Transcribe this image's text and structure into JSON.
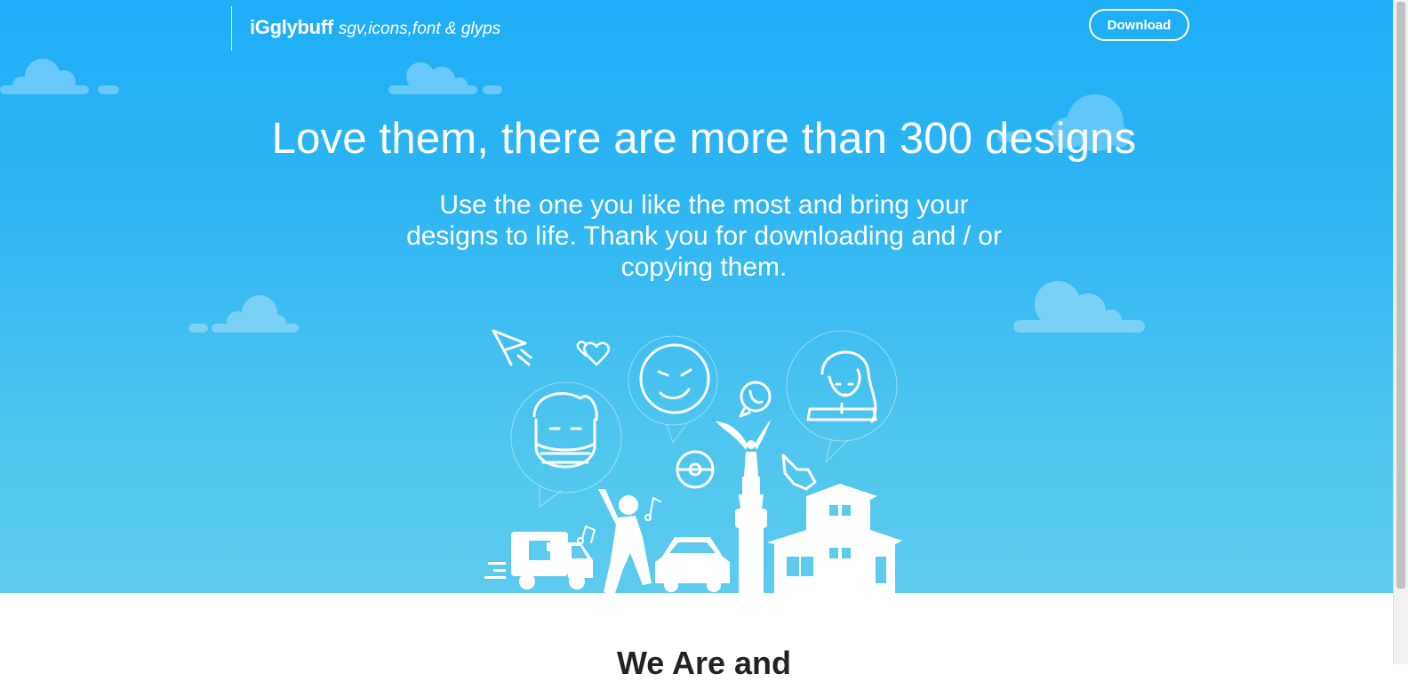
{
  "header": {
    "brand_name": "iGglybuff",
    "brand_tagline": "sgv,icons,font & glyps",
    "download_label": "Download"
  },
  "hero": {
    "headline": "Love them, there are more than 300 designs",
    "subtext": "Use the one you like the most and bring your designs to life. Thank you for downloading and / or copying them.",
    "background_top": "#1eaef7",
    "background_bottom": "#5ccbee"
  },
  "next_section": {
    "title": "We Are and"
  },
  "icons": [
    "cloud-icon",
    "paper-plane-icon",
    "hearts-icon",
    "smiley-face-icon",
    "whatsapp-icon",
    "woman-avatar-icon",
    "masked-man-icon",
    "pokeball-icon",
    "angel-monument-icon",
    "pointer-hand-icon",
    "music-note-icon",
    "dancing-person-icon",
    "delivery-truck-icon",
    "car-icon",
    "house-icon"
  ]
}
